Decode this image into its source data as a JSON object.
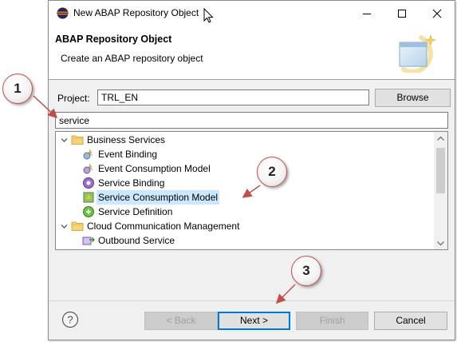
{
  "window": {
    "title": "New ABAP Repository Object"
  },
  "header": {
    "title": "ABAP Repository Object",
    "description": "Create an ABAP repository object"
  },
  "project": {
    "label": "Project:",
    "value": "TRL_EN",
    "browse_label": "Browse"
  },
  "filter": {
    "value": "service"
  },
  "tree": {
    "items": [
      {
        "label": "Business Services",
        "icon": "folder-icon",
        "level": 0,
        "expanded": true
      },
      {
        "label": "Event Binding",
        "icon": "event-binding-icon",
        "level": 1
      },
      {
        "label": "Event Consumption Model",
        "icon": "event-consumption-icon",
        "level": 1
      },
      {
        "label": "Service Binding",
        "icon": "service-binding-icon",
        "level": 1
      },
      {
        "label": "Service Consumption Model",
        "icon": "service-consumption-icon",
        "level": 1,
        "selected": true
      },
      {
        "label": "Service Definition",
        "icon": "service-definition-icon",
        "level": 1
      },
      {
        "label": "Cloud Communication Management",
        "icon": "folder-icon",
        "level": 0,
        "expanded": true
      },
      {
        "label": "Outbound Service",
        "icon": "outbound-service-icon",
        "level": 1
      }
    ]
  },
  "buttons": {
    "back": "< Back",
    "next": "Next >",
    "finish": "Finish",
    "cancel": "Cancel"
  },
  "callouts": [
    "1",
    "2",
    "3"
  ],
  "colors": {
    "selection": "#cce8ff",
    "callout_border": "#c0504d",
    "default_button": "#0078d7"
  }
}
